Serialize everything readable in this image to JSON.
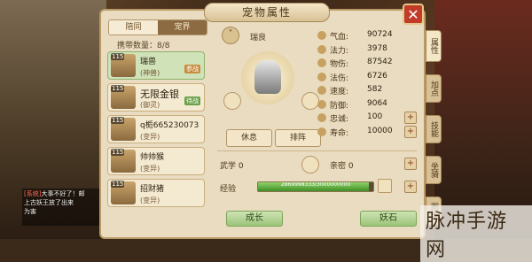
{
  "window": {
    "title": "宠物属性",
    "close_label": "✕"
  },
  "top_tabs": [
    {
      "label": "陪同"
    },
    {
      "label": "宠界"
    }
  ],
  "carry_count": "携带数量：8/8",
  "pets": [
    {
      "level": "115",
      "name": "瑞兽",
      "type": "(神兽)",
      "badge": "参战"
    },
    {
      "level": "115",
      "name": "无限金银",
      "type": "(御灵)",
      "badge": "待战"
    },
    {
      "level": "115",
      "name": "q栀665230073",
      "type": "(变异)",
      "badge": ""
    },
    {
      "level": "115",
      "name": "帅帅猴",
      "type": "(变异)",
      "badge": ""
    },
    {
      "level": "115",
      "name": "招财猪",
      "type": "(变异)",
      "badge": ""
    }
  ],
  "current_pet": {
    "name": "瑞良",
    "chevron": "˅"
  },
  "action_buttons": {
    "rest": "休息",
    "formation": "排阵"
  },
  "stats": [
    {
      "label": "气血:",
      "value": "90724"
    },
    {
      "label": "法力:",
      "value": "3978"
    },
    {
      "label": "物伤:",
      "value": "87542"
    },
    {
      "label": "法伤:",
      "value": "6726"
    },
    {
      "label": "速度:",
      "value": "582"
    },
    {
      "label": "防御:",
      "value": "9064"
    },
    {
      "label": "忠诚:",
      "value": "100"
    },
    {
      "label": "寿命:",
      "value": "10000"
    }
  ],
  "wuxue": {
    "label": "武学",
    "value": "0"
  },
  "qinmi": {
    "label": "亲密",
    "value": "0"
  },
  "exp": {
    "label": "经验",
    "text": "2869998333/3000000000",
    "progress": 0.96
  },
  "bottom_buttons": {
    "grow": "成长",
    "stone": "妖石"
  },
  "right_tabs": [
    "属性",
    "加点",
    "技能",
    "坐骑",
    "图鉴"
  ],
  "chat": {
    "line1_prefix": "[系统]",
    "line1": "大事不好了！邮",
    "line2": "上古妖王放了出来",
    "line3": "为害"
  },
  "watermark": "脉冲手游网",
  "colors": {
    "panel": "#e9dcc0",
    "accent": "#c23a28",
    "exp": "#3f8e25"
  }
}
